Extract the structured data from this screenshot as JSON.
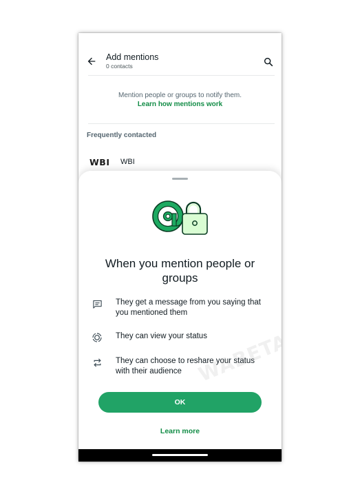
{
  "appbar": {
    "title": "Add mentions",
    "subtitle": "0 contacts",
    "back_icon": "arrow-back-icon",
    "search_icon": "search-icon"
  },
  "info": {
    "text": "Mention people or groups to notify them.",
    "link": "Learn how mentions work"
  },
  "section": {
    "header": "Frequently contacted"
  },
  "contacts": [
    {
      "logo": "WBI",
      "name": "WBI"
    }
  ],
  "sheet": {
    "illustration_icon": "at-sign-lock-icon",
    "title": "When you mention people or groups",
    "features": [
      {
        "icon": "message-icon",
        "text": "They get a message from you saying that you mentioned them"
      },
      {
        "icon": "status-icon",
        "text": "They can view your status"
      },
      {
        "icon": "reshare-icon",
        "text": "They can choose to reshare your status with their audience"
      }
    ],
    "ok_label": "OK",
    "learn_more": "Learn more"
  },
  "watermark": "WABETAINFO",
  "colors": {
    "accent": "#21a366",
    "link": "#128c46",
    "illustration_green": "#1daa61",
    "illustration_light": "#d9fdd3"
  }
}
